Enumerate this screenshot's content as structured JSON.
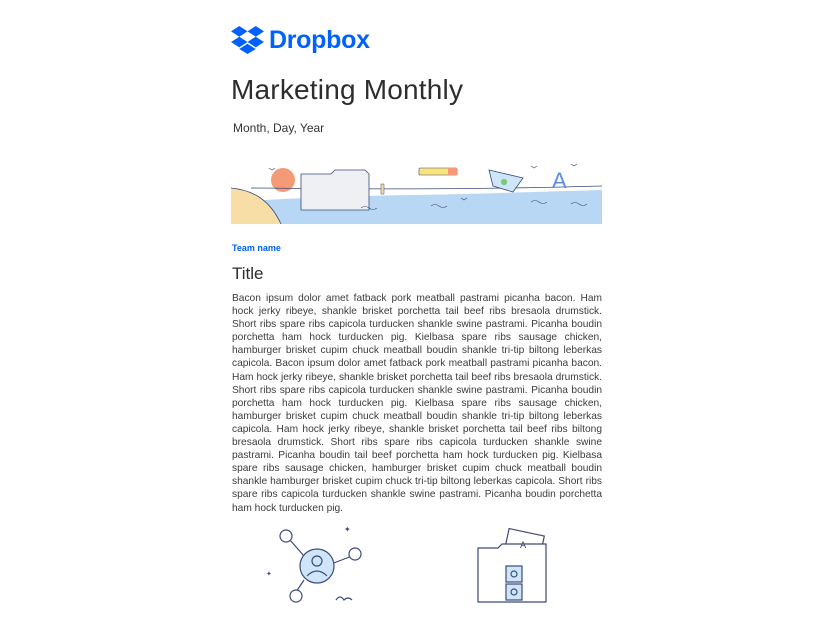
{
  "brand": {
    "name": "Dropbox",
    "color": "#0061fe"
  },
  "newsletter": {
    "title": "Marketing Monthly",
    "date": "Month, Day, Year",
    "team_name": "Team name",
    "section_title": "Title",
    "body": "Bacon ipsum dolor amet fatback pork meatball pastrami picanha bacon. Ham hock jerky ribeye, shankle brisket porchetta tail beef ribs bresaola drumstick. Short ribs spare ribs capicola turducken shankle swine pastrami. Picanha boudin porchetta ham hock turducken pig. Kielbasa spare ribs sausage chicken, hamburger brisket cupim chuck meatball boudin shankle tri-tip biltong leberkas capicola. Bacon ipsum dolor amet fatback pork meatball pastrami picanha bacon. Ham hock jerky ribeye, shankle brisket porchetta tail beef ribs bresaola drumstick. Short ribs spare ribs capicola turducken shankle swine pastrami. Picanha boudin porchetta ham hock turducken pig. Kielbasa spare ribs sausage chicken, hamburger brisket cupim chuck meatball boudin shankle tri-tip biltong leberkas capicola. Ham hock jerky ribeye, shankle brisket porchetta tail beef ribs biltong bresaola drumstick. Short ribs spare ribs capicola turducken shankle swine pastrami. Picanha boudin tail beef porchetta ham hock turducken pig. Kielbasa spare ribs sausage chicken, hamburger brisket cupim chuck meatball boudin shankle hamburger brisket cupim chuck tri-tip biltong leberkas capicola. Short ribs spare ribs capicola turducken shankle swine pastrami. Picanha boudin porchetta ham hock turducken pig."
  },
  "icons": {
    "logo": "dropbox-logo-icon",
    "banner": "banner-illustration",
    "network": "user-network-illustration",
    "folder": "file-folder-illustration"
  },
  "colors": {
    "text": "#2d2d2d",
    "water": "#b7d7f4",
    "sand": "#f6dea6",
    "sun": "#f59a76",
    "line_art": "#3b4a78"
  }
}
